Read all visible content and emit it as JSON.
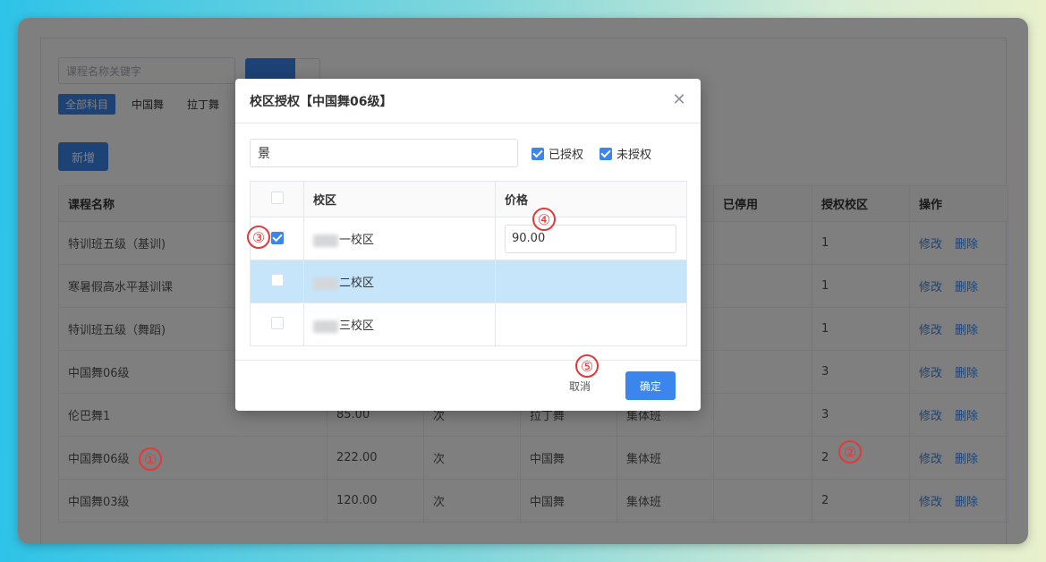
{
  "filters": {
    "search_placeholder": "课程名称关键字",
    "categories": [
      "全部科目",
      "中国舞",
      "拉丁舞"
    ]
  },
  "add_button": "新增",
  "table": {
    "headers": [
      "课程名称",
      "",
      "",
      "",
      "",
      "已停用",
      "授权校区",
      "操作"
    ],
    "rows": [
      {
        "name": "特训班五级（基训)",
        "price": "",
        "unit": "",
        "subject": "",
        "type": "",
        "campus_count": "1"
      },
      {
        "name": "寒暑假高水平基训课",
        "price": "",
        "unit": "",
        "subject": "",
        "type": "",
        "campus_count": "1"
      },
      {
        "name": "特训班五级（舞蹈)",
        "price": "",
        "unit": "",
        "subject": "",
        "type": "",
        "campus_count": "1"
      },
      {
        "name": "中国舞06级",
        "price": "",
        "unit": "",
        "subject": "",
        "type": "",
        "campus_count": "3"
      },
      {
        "name": "伦巴舞1",
        "price": "85.00",
        "unit": "次",
        "subject": "拉丁舞",
        "type": "集体班",
        "campus_count": "3"
      },
      {
        "name": "中国舞06级",
        "price": "222.00",
        "unit": "次",
        "subject": "中国舞",
        "type": "集体班",
        "campus_count": "2"
      },
      {
        "name": "中国舞03级",
        "price": "120.00",
        "unit": "次",
        "subject": "中国舞",
        "type": "集体班",
        "campus_count": "2"
      }
    ],
    "edit_label": "修改",
    "delete_label": "删除"
  },
  "dialog": {
    "title": "校区授权【中国舞06级】",
    "search_value": "景",
    "authorized_label": "已授权",
    "unauthorized_label": "未授权",
    "col_campus": "校区",
    "col_price": "价格",
    "rows": [
      {
        "campus": "一校区",
        "price": "90.00",
        "checked": true
      },
      {
        "campus": "二校区",
        "price": "",
        "checked": false
      },
      {
        "campus": "三校区",
        "price": "",
        "checked": false
      }
    ],
    "cancel_label": "取消",
    "ok_label": "确定"
  },
  "markers": [
    "①",
    "②",
    "③",
    "④",
    "⑤"
  ],
  "colors": {
    "accent": "#3a86ec",
    "marker": "#e03a3a",
    "highlight_row": "#c6e5fb"
  }
}
